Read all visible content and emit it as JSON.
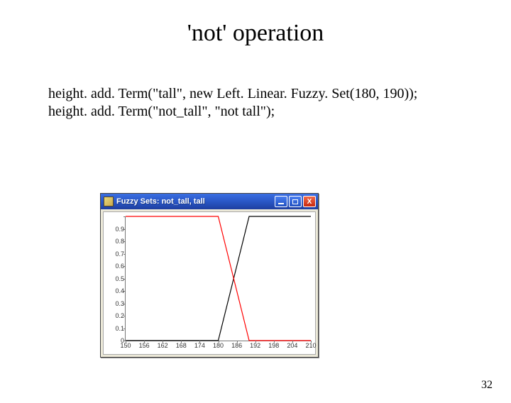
{
  "slide": {
    "title": "'not' operation",
    "page_number": "32"
  },
  "code": {
    "line1": "height. add. Term(\"tall\", new Left. Linear. Fuzzy. Set(180, 190));",
    "line2": "height. add. Term(\"not_tall\", \"not tall\");"
  },
  "window": {
    "title": "Fuzzy Sets:  not_tall, tall",
    "buttons": {
      "min": "_",
      "max": "□",
      "close": "X"
    }
  },
  "chart_data": {
    "type": "line",
    "xlabel": "",
    "ylabel": "",
    "xlim": [
      150,
      210
    ],
    "ylim": [
      0,
      1
    ],
    "x_ticks": [
      150,
      156,
      162,
      168,
      174,
      180,
      186,
      192,
      198,
      204,
      210
    ],
    "y_ticks": [
      0,
      0.1,
      0.2,
      0.3,
      0.4,
      0.5,
      0.6,
      0.7,
      0.8,
      0.9,
      1
    ],
    "y_tick_labels": [
      "0",
      "0.1",
      "0.2",
      "0.3",
      "0.4",
      "0.5",
      "0.6",
      "0.7",
      "0.8",
      "0.9",
      ""
    ],
    "series": [
      {
        "name": "tall",
        "color": "#000000",
        "x": [
          150,
          180,
          190,
          210
        ],
        "y": [
          0,
          0,
          1,
          1
        ]
      },
      {
        "name": "not_tall",
        "color": "#ff0000",
        "x": [
          150,
          180,
          190,
          210
        ],
        "y": [
          1,
          1,
          0,
          0
        ]
      }
    ]
  }
}
